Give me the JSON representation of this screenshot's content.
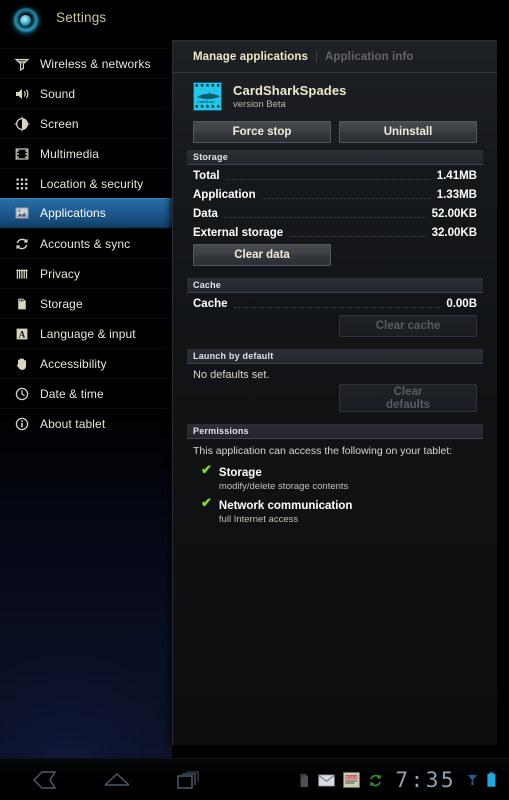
{
  "brand": {
    "logo_icon": "settings-orb-icon",
    "title": "Settings"
  },
  "sidebar": {
    "items": [
      {
        "label": "Wireless & networks",
        "icon": "wifi-icon",
        "selected": false
      },
      {
        "label": "Sound",
        "icon": "speaker-icon",
        "selected": false
      },
      {
        "label": "Screen",
        "icon": "brightness-icon",
        "selected": false
      },
      {
        "label": "Multimedia",
        "icon": "film-icon",
        "selected": false
      },
      {
        "label": "Location & security",
        "icon": "grid-icon",
        "selected": false
      },
      {
        "label": "Applications",
        "icon": "apps-image-icon",
        "selected": true
      },
      {
        "label": "Accounts & sync",
        "icon": "sync-icon",
        "selected": false
      },
      {
        "label": "Privacy",
        "icon": "fingerprint-icon",
        "selected": false
      },
      {
        "label": "Storage",
        "icon": "sdcard-icon",
        "selected": false
      },
      {
        "label": "Language & input",
        "icon": "letter-a-icon",
        "selected": false
      },
      {
        "label": "Accessibility",
        "icon": "hand-icon",
        "selected": false
      },
      {
        "label": "Date & time",
        "icon": "clock-icon",
        "selected": false
      },
      {
        "label": "About tablet",
        "icon": "info-icon",
        "selected": false
      }
    ]
  },
  "content": {
    "tabs": [
      {
        "label": "Manage applications",
        "state": "active"
      },
      {
        "label": "Application info",
        "state": "inactive"
      }
    ],
    "app": {
      "icon": "cardsharkspades-app-icon",
      "icon_spade_glyph": "♠",
      "icon_word": "CardShark",
      "name": "CardSharkSpades",
      "version": "version Beta"
    },
    "actions": [
      {
        "label": "Force stop",
        "disabled": false
      },
      {
        "label": "Uninstall",
        "disabled": false
      }
    ],
    "storage": {
      "header": "Storage",
      "rows": [
        {
          "label": "Total",
          "value": "1.41MB"
        },
        {
          "label": "Application",
          "value": "1.33MB"
        },
        {
          "label": "Data",
          "value": "52.00KB"
        },
        {
          "label": "External storage",
          "value": "32.00KB"
        }
      ],
      "button": {
        "label": "Clear data",
        "disabled": false
      }
    },
    "cache": {
      "header": "Cache",
      "row": {
        "label": "Cache",
        "value": "0.00B"
      },
      "button": {
        "label": "Clear cache",
        "disabled": true
      }
    },
    "launch_by_default": {
      "header": "Launch by default",
      "note": "No defaults set.",
      "button": {
        "line1": "Clear",
        "line2": "defaults",
        "disabled": true
      }
    },
    "permissions": {
      "header": "Permissions",
      "intro": "This application can access the following on your tablet:",
      "check_glyph": "✔",
      "check_color": "#7ee022",
      "items": [
        {
          "title": "Storage",
          "desc": "modify/delete storage contents"
        },
        {
          "title": "Network communication",
          "desc": "full Internet access"
        }
      ]
    }
  },
  "system_bar": {
    "nav": [
      {
        "icon": "back-icon"
      },
      {
        "icon": "home-icon"
      },
      {
        "icon": "recent-apps-icon"
      }
    ],
    "status": [
      {
        "icon": "sdcard-status-icon"
      },
      {
        "icon": "email-icon"
      },
      {
        "icon": "app-notification-icon"
      },
      {
        "icon": "sync-status-icon"
      }
    ],
    "clock": "7:35",
    "trailing": [
      {
        "icon": "download-icon"
      },
      {
        "icon": "battery-icon"
      }
    ]
  },
  "colors": {
    "accent_selected": "#1f5d95",
    "label_gold": "#efe9c9",
    "permission_green": "#7ee022",
    "clock_blue": "#8fa3b4"
  }
}
